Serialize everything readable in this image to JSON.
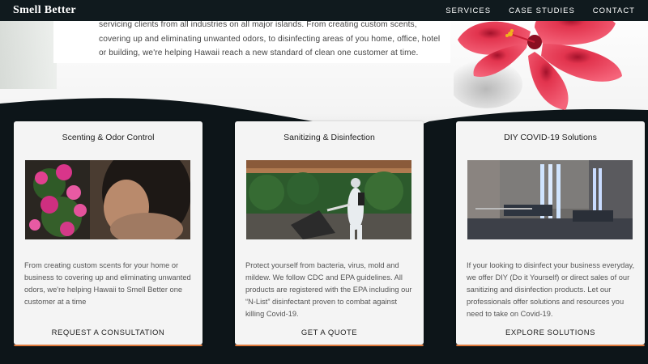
{
  "nav": {
    "logo": "Smell Better",
    "links": [
      "SERVICES",
      "CASE STUDIES",
      "CONTACT"
    ]
  },
  "hero": {
    "text": "servicing clients from all industries on all major islands. From creating custom scents, covering up and eliminating unwanted odors, to disinfecting areas of you home, office, hotel or building, we're helping Hawaii reach a new standard of clean one customer at time."
  },
  "cards": [
    {
      "title": "Scenting & Odor Control",
      "text": "From creating custom scents for your home or business to covering up and eliminating unwanted odors, we're helping Hawaii to Smell Better one customer at a time",
      "cta": "REQUEST A CONSULTATION"
    },
    {
      "title": "Sanitizing & Disinfection",
      "text": "Protect yourself from bacteria, virus, mold and mildew. We follow CDC and EPA guidelines. All products are registered with the EPA including our “N-List” disinfectant proven to combat against killing Covid-19.",
      "cta": "GET A QUOTE"
    },
    {
      "title": "DIY COVID-19 Solutions",
      "text": "If your looking to disinfect your business everyday, we offer DIY (Do it Yourself) or direct sales of our sanitizing and disinfection products. Let our professionals offer solutions and resources you need to take on Covid-19.",
      "cta": "EXPLORE SOLUTIONS"
    }
  ],
  "colors": {
    "nav_bg": "#101a1e",
    "page_bg": "#0d1519",
    "card_bg": "#f4f4f4",
    "card_accent": "#e07a3c"
  }
}
